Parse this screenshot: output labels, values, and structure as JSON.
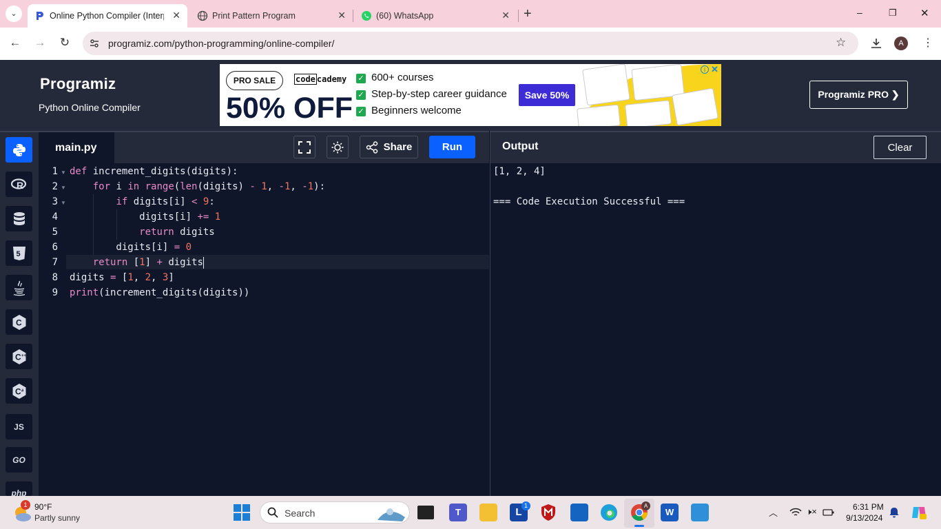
{
  "browser": {
    "tabs": [
      {
        "title": "Online Python Compiler (Interp",
        "active": true
      },
      {
        "title": "Print Pattern Program",
        "active": false
      },
      {
        "title": "(60) WhatsApp",
        "active": false
      }
    ],
    "new_tab_symbol": "+",
    "url": "programiz.com/python-programming/online-compiler/",
    "profile_initial": "A",
    "window_controls": {
      "minimize": "–",
      "restore": "❐",
      "close": "✕"
    }
  },
  "site": {
    "logo": "Programiz",
    "subtitle": "Python Online Compiler",
    "pro_button": "Programiz PRO ❯"
  },
  "ad": {
    "badge": "PRO SALE",
    "brand_a": "code",
    "brand_b": "cademy",
    "discount": "50% OFF",
    "bullets": [
      "600+ courses",
      "Step-by-step career guidance",
      "Beginners welcome"
    ],
    "cta": "Save 50%"
  },
  "sidebar": {
    "items": [
      {
        "name": "python",
        "label": "",
        "active": true
      },
      {
        "name": "r",
        "label": "R"
      },
      {
        "name": "sql",
        "label": ""
      },
      {
        "name": "html",
        "label": "5"
      },
      {
        "name": "java",
        "label": ""
      },
      {
        "name": "c",
        "label": "C"
      },
      {
        "name": "cpp",
        "label": "C"
      },
      {
        "name": "csharp",
        "label": "C"
      },
      {
        "name": "javascript",
        "label": "JS"
      },
      {
        "name": "go",
        "label": "GO"
      },
      {
        "name": "php",
        "label": "php"
      }
    ]
  },
  "editor": {
    "filename": "main.py",
    "share_label": "Share",
    "run_label": "Run",
    "line_numbers": [
      "1",
      "2",
      "3",
      "4",
      "5",
      "6",
      "7",
      "8",
      "9"
    ]
  },
  "output": {
    "title": "Output",
    "clear_label": "Clear",
    "lines": [
      "[1, 2, 4]",
      "",
      "=== Code Execution Successful ==="
    ]
  },
  "taskbar": {
    "weather_temp": "90°F",
    "weather_desc": "Partly sunny",
    "weather_badge": "1",
    "search_placeholder": "Search",
    "time": "6:31 PM",
    "date": "9/13/2024",
    "teams_badge": "1",
    "chrome_badge": "A"
  },
  "colors": {
    "tab_strip": "#f7d1db",
    "header_bg": "#242a3a",
    "editor_bg": "#0f1629",
    "run_button": "#0b61ff",
    "keyword": "#e78bc9",
    "number": "#f27560"
  }
}
